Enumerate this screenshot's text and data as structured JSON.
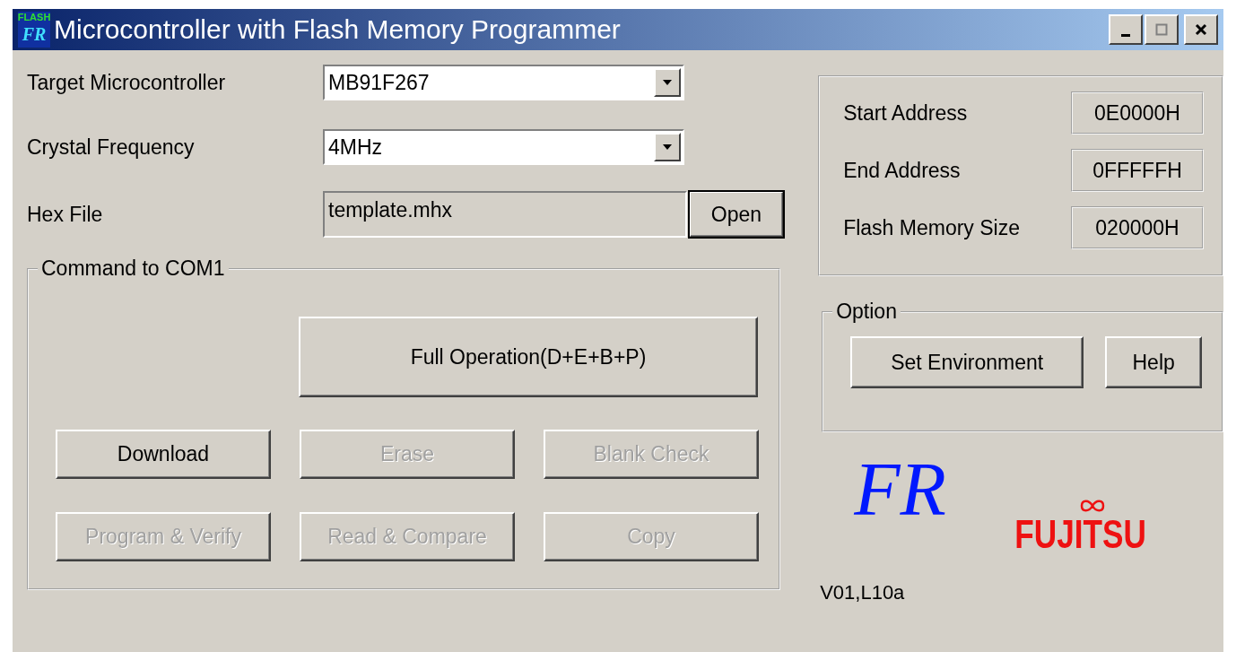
{
  "window": {
    "title": "Microcontroller with Flash Memory Programmer",
    "icon_top": "FLASH",
    "icon_bottom": "FR"
  },
  "target": {
    "label": "Target Microcontroller",
    "value": "MB91F267"
  },
  "crystal": {
    "label": "Crystal Frequency",
    "value": "4MHz"
  },
  "hex_file": {
    "label": "Hex File",
    "value": "template.mhx",
    "button": "Open"
  },
  "command_group": {
    "title": "Command to COM1",
    "full_operation": {
      "label": "Full Operation(D+E+B+P)",
      "disabled": false
    },
    "buttons": [
      {
        "label": "Download",
        "disabled": false
      },
      {
        "label": "Erase",
        "disabled": true
      },
      {
        "label": "Blank Check",
        "disabled": true
      },
      {
        "label": "Program & Verify",
        "disabled": true
      },
      {
        "label": "Read & Compare",
        "disabled": true
      },
      {
        "label": "Copy",
        "disabled": true
      }
    ]
  },
  "memory_info": [
    {
      "label": "Start Address",
      "value": "0E0000H"
    },
    {
      "label": "End Address",
      "value": "0FFFFFH"
    },
    {
      "label": "Flash Memory Size",
      "value": "020000H"
    }
  ],
  "option_group": {
    "title": "Option",
    "buttons": [
      {
        "label": "Set Environment",
        "disabled": false
      },
      {
        "label": "Help",
        "disabled": false
      }
    ]
  },
  "logo": {
    "product": "FR",
    "company": "FUJITSU"
  },
  "version": "V01,L10a"
}
